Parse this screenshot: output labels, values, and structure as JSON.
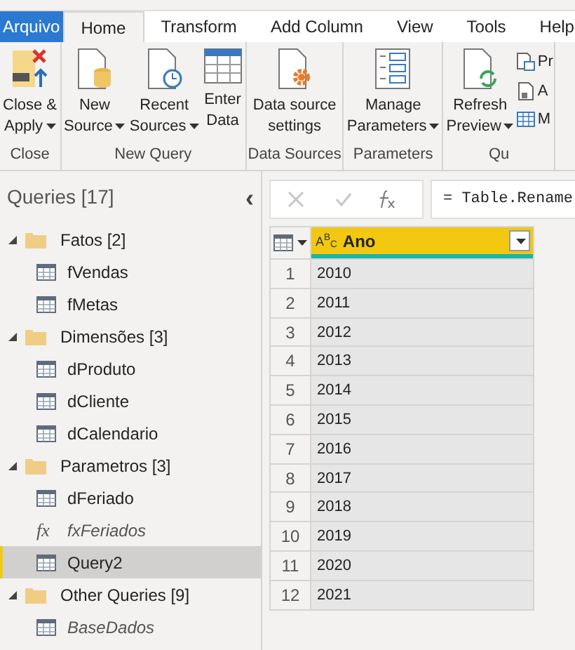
{
  "tabs": [
    {
      "label": "Arquivo",
      "kind": "file",
      "selected": false
    },
    {
      "label": "Home",
      "kind": "normal",
      "selected": true
    },
    {
      "label": "Transform",
      "kind": "normal",
      "selected": false
    },
    {
      "label": "Add Column",
      "kind": "normal",
      "selected": false
    },
    {
      "label": "View",
      "kind": "normal",
      "selected": false
    },
    {
      "label": "Tools",
      "kind": "normal",
      "selected": false
    },
    {
      "label": "Help",
      "kind": "normal",
      "selected": false
    }
  ],
  "ribbon_groups": [
    {
      "label": "Close",
      "buttons": [
        {
          "lines": [
            "Close &",
            "Apply"
          ],
          "dropdown": true
        }
      ]
    },
    {
      "label": "New Query",
      "buttons": [
        {
          "lines": [
            "New",
            "Source"
          ],
          "dropdown": true
        },
        {
          "lines": [
            "Recent",
            "Sources"
          ],
          "dropdown": true
        },
        {
          "lines": [
            "Enter",
            "Data"
          ],
          "dropdown": false
        }
      ]
    },
    {
      "label": "Data Sources",
      "buttons": [
        {
          "lines": [
            "Data source",
            "settings"
          ],
          "dropdown": false
        }
      ]
    },
    {
      "label": "Parameters",
      "buttons": [
        {
          "lines": [
            "Manage",
            "Parameters"
          ],
          "dropdown": true
        }
      ]
    },
    {
      "label": "Qu",
      "buttons": [
        {
          "lines": [
            "Refresh",
            "Preview"
          ],
          "dropdown": true
        }
      ],
      "small_buttons": [
        {
          "label": "Pr"
        },
        {
          "label": "A"
        },
        {
          "label": "M"
        }
      ]
    }
  ],
  "queries": {
    "title": "Queries [17]",
    "collapse": "‹",
    "groups": [
      {
        "label": "Fatos [2]",
        "expanded": true,
        "children": [
          {
            "label": "fVendas",
            "kind": "table",
            "selected": false,
            "load_disabled": false
          },
          {
            "label": "fMetas",
            "kind": "table",
            "selected": false,
            "load_disabled": false
          }
        ]
      },
      {
        "label": "Dimensões [3]",
        "expanded": true,
        "children": [
          {
            "label": "dProduto",
            "kind": "table",
            "selected": false,
            "load_disabled": false
          },
          {
            "label": "dCliente",
            "kind": "table",
            "selected": false,
            "load_disabled": false
          },
          {
            "label": "dCalendario",
            "kind": "table",
            "selected": false,
            "load_disabled": false
          }
        ]
      },
      {
        "label": "Parametros [3]",
        "expanded": true,
        "children": [
          {
            "label": "dFeriado",
            "kind": "table",
            "selected": false,
            "load_disabled": false
          },
          {
            "label": "fxFeriados",
            "kind": "function",
            "glyph": "fx",
            "selected": false,
            "load_disabled": true
          },
          {
            "label": "Query2",
            "kind": "table",
            "selected": true,
            "load_disabled": false
          }
        ]
      },
      {
        "label": "Other Queries [9]",
        "expanded": true,
        "children": [
          {
            "label": "BaseDados",
            "kind": "table",
            "selected": false,
            "load_disabled": true
          }
        ]
      }
    ]
  },
  "formula_bar": {
    "cancel_enabled": false,
    "commit_enabled": false,
    "formula": "= Table.Rename"
  },
  "table": {
    "columns": [
      {
        "kind": "menu"
      },
      {
        "kind": "data",
        "label": "Ano",
        "type_label": "A$^{B}$$_{C}$",
        "selected": true
      }
    ],
    "rows": [
      [
        "1",
        "2010"
      ],
      [
        "2",
        "2011"
      ],
      [
        "3",
        "2012"
      ],
      [
        "4",
        "2013"
      ],
      [
        "5",
        "2014"
      ],
      [
        "6",
        "2015"
      ],
      [
        "7",
        "2016"
      ],
      [
        "8",
        "2017"
      ],
      [
        "9",
        "2018"
      ],
      [
        "10",
        "2019"
      ],
      [
        "11",
        "2020"
      ],
      [
        "12",
        "2021"
      ]
    ]
  }
}
